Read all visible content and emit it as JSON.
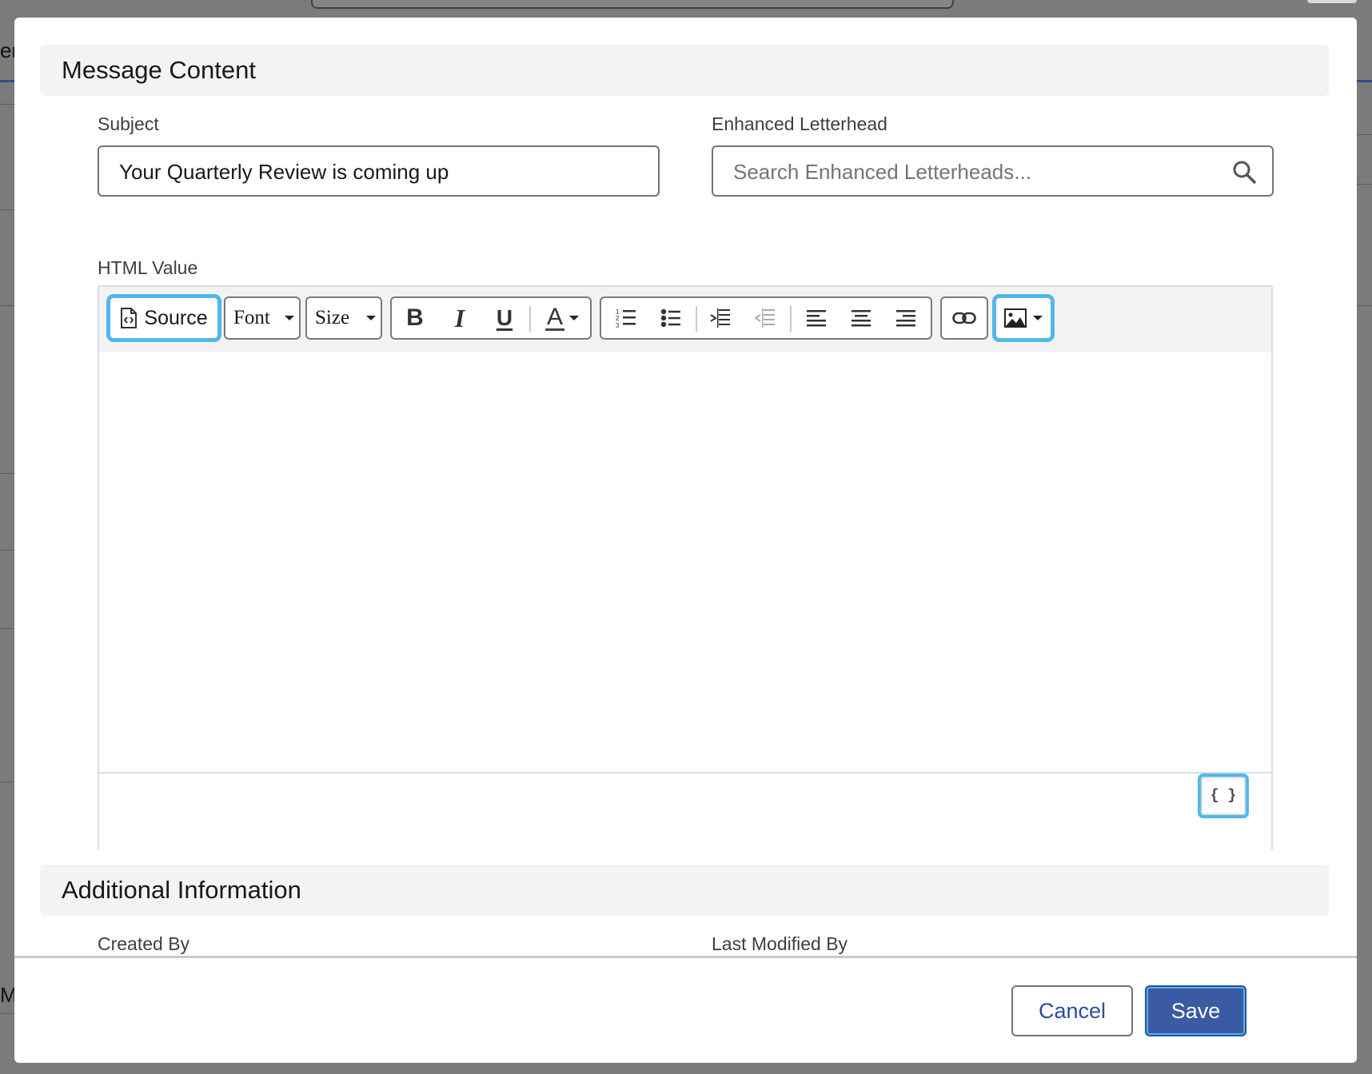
{
  "background": {
    "left_text_top": "en",
    "left_text_bottom": "M"
  },
  "message_content": {
    "section_title": "Message Content",
    "subject": {
      "label": "Subject",
      "value": "Your Quarterly Review is coming up"
    },
    "letterhead": {
      "label": "Enhanced Letterhead",
      "placeholder": "Search Enhanced Letterheads...",
      "icon": "search-icon"
    },
    "html_value": {
      "label": "HTML Value",
      "toolbar": {
        "source_label": "Source",
        "font_label": "Font",
        "size_label": "Size",
        "bold_glyph": "B",
        "italic_glyph": "I",
        "underline_glyph": "U",
        "text_color_glyph": "A"
      },
      "merge_field_glyph": "{ }"
    }
  },
  "additional_information": {
    "section_title": "Additional Information",
    "created_by_label": "Created By",
    "last_modified_by_label": "Last Modified By"
  },
  "footer": {
    "cancel_label": "Cancel",
    "save_label": "Save"
  },
  "colors": {
    "accent_focus": "#52b7ea",
    "brand_button": "#3a5aa4",
    "link_text": "#2a4da0"
  }
}
